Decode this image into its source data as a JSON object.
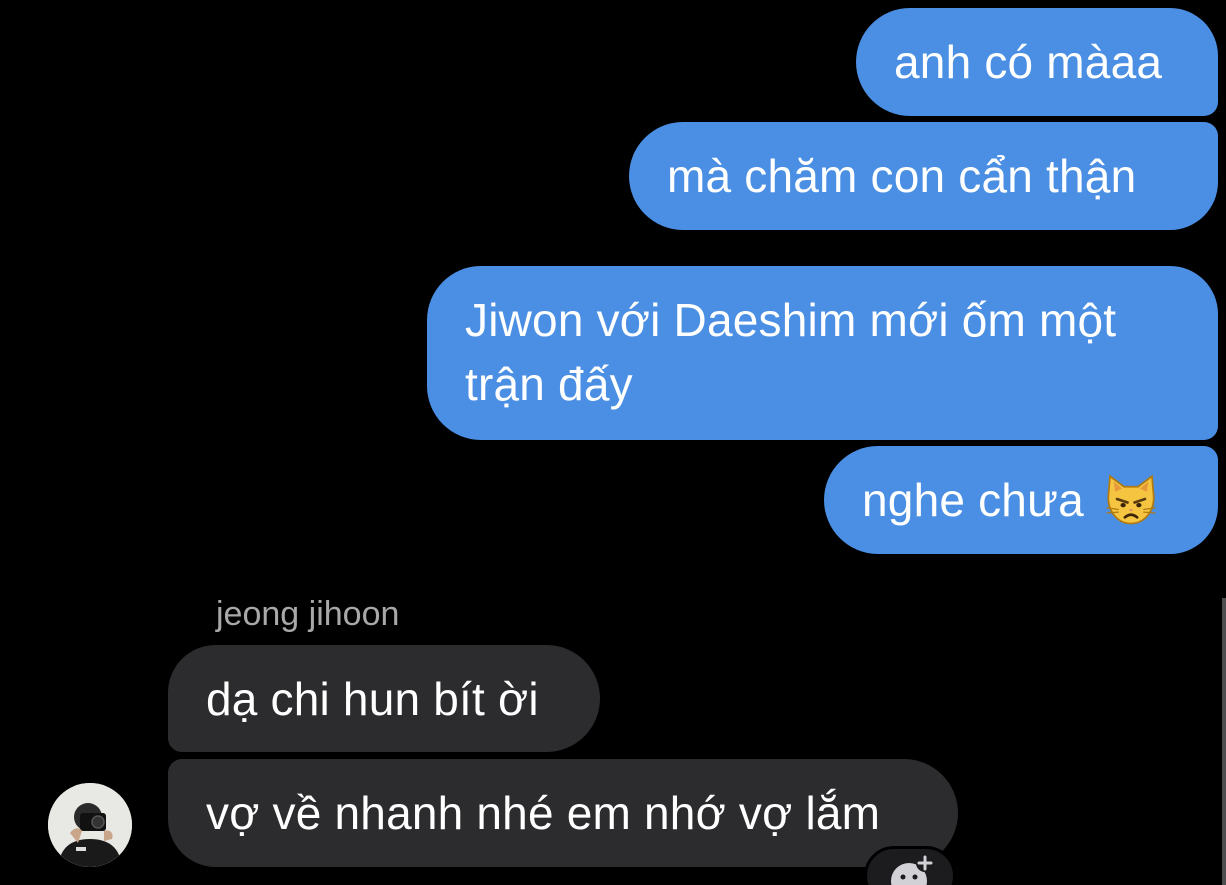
{
  "conversation": {
    "outgoing": [
      {
        "text": "anh có màaa"
      },
      {
        "text": "mà chăm con cẩn thận"
      },
      {
        "text": "Jiwon với Daeshim mới ốm một trận đấy"
      },
      {
        "text": "nghe chưa",
        "emoji": "pouting-cat-emoji"
      }
    ],
    "incoming": {
      "sender_name": "jeong jihoon",
      "messages": [
        {
          "text": "dạ chi hun bít ời"
        },
        {
          "text": "vợ về nhanh nhé em nhớ vợ lắm"
        }
      ],
      "avatar_icon": "contact-avatar"
    },
    "reaction_button_icon": "add-reaction-icon"
  },
  "colors": {
    "outgoing_bubble": "#4a8fe3",
    "incoming_bubble": "#2c2c2e",
    "background": "#000000",
    "sender_name": "#a8a8a8"
  }
}
